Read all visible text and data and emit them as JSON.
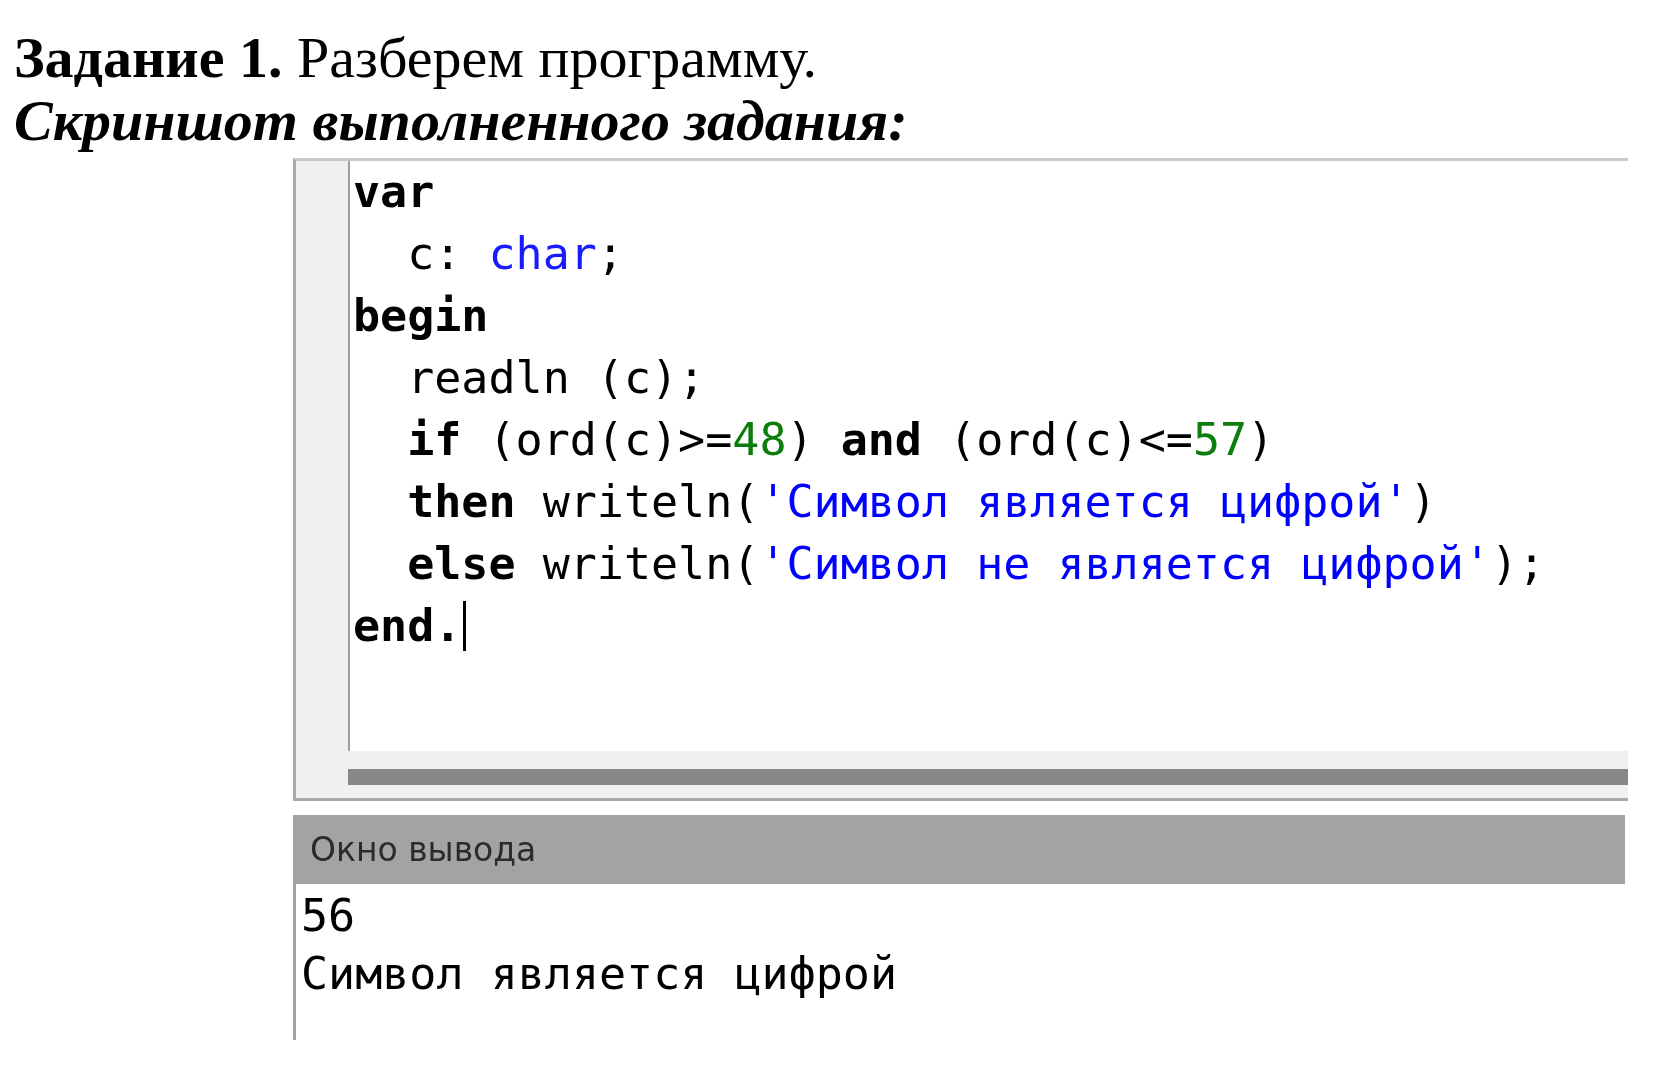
{
  "heading": {
    "title": "**Задание 1.** Разберем программу.",
    "subtitle": "Скриншот выполненного задания:"
  },
  "editor": {
    "lines": [
      {
        "tokens": [
          {
            "kind": "keyword",
            "text": "var"
          }
        ],
        "cursor": false,
        "children": [
          {
            "tokens": [
              {
                "kind": "plain",
                "text": "c: "
              },
              {
                "kind": "type",
                "text": "char"
              },
              {
                "kind": "plain",
                "text": ";"
              }
            ],
            "cursor": false
          }
        ]
      },
      {
        "tokens": [
          {
            "kind": "keyword",
            "text": "begin"
          }
        ],
        "cursor": false,
        "children": [
          {
            "tokens": [
              {
                "kind": "plain",
                "text": "readln (c);"
              }
            ],
            "cursor": false
          },
          {
            "tokens": [
              {
                "kind": "keyword",
                "text": "if"
              },
              {
                "kind": "plain",
                "text": " (ord(c)>="
              },
              {
                "kind": "number",
                "text": "48"
              },
              {
                "kind": "plain",
                "text": ") "
              },
              {
                "kind": "keyword",
                "text": "and"
              },
              {
                "kind": "plain",
                "text": " (ord(c)<="
              },
              {
                "kind": "number",
                "text": "57"
              },
              {
                "kind": "plain",
                "text": ")"
              }
            ],
            "cursor": false
          },
          {
            "tokens": [
              {
                "kind": "keyword",
                "text": "then"
              },
              {
                "kind": "plain",
                "text": " writeln("
              },
              {
                "kind": "string",
                "text": "'Символ является цифрой'"
              },
              {
                "kind": "plain",
                "text": ")"
              }
            ],
            "cursor": false
          },
          {
            "tokens": [
              {
                "kind": "keyword",
                "text": "else"
              },
              {
                "kind": "plain",
                "text": " writeln("
              },
              {
                "kind": "string",
                "text": "'Символ не является цифрой'"
              },
              {
                "kind": "plain",
                "text": ");"
              }
            ],
            "cursor": false
          }
        ]
      },
      {
        "tokens": [
          {
            "kind": "keyword",
            "text": "end."
          }
        ],
        "cursor": true
      }
    ]
  },
  "output_window": {
    "title": "Окно вывода",
    "lines": [
      "56",
      "Символ является цифрой"
    ]
  }
}
